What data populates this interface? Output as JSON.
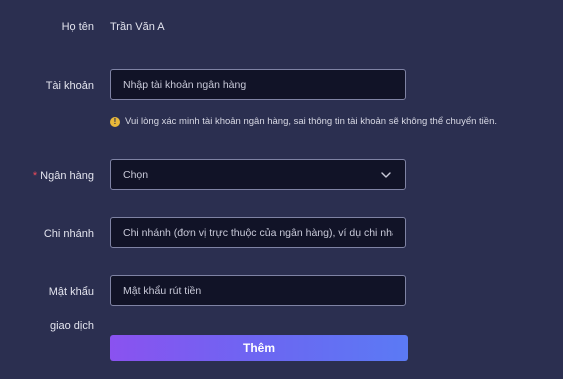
{
  "form": {
    "name": {
      "label": "Họ tên",
      "value": "Trần Văn A"
    },
    "account": {
      "label": "Tài khoản",
      "placeholder": "Nhập tài khoản ngân hàng",
      "value": "",
      "hint_icon": "info-icon",
      "hint": "Vui lòng xác minh tài khoản ngân hàng, sai thông tin tài khoản sẽ không thể chuyển tiền."
    },
    "bank": {
      "required_mark": "*",
      "label": "Ngân hàng",
      "selected": "Chọn",
      "icon": "chevron-down-icon"
    },
    "branch": {
      "label": "Chi nhánh",
      "placeholder": "Chi nhánh (đơn vị trực thuộc của ngân hàng), ví dụ chi nhánh",
      "value": ""
    },
    "password": {
      "label_line1": "Mật khẩu",
      "label_line2": "giao dịch",
      "placeholder": "Mật khẩu rút tiền",
      "value": ""
    },
    "submit_label": "Thêm"
  },
  "colors": {
    "background": "#2b2f50",
    "field_background": "#111327",
    "field_border": "#7f83a4",
    "required": "#ef4b5a",
    "info": "#e8b83a",
    "button_gradient_start": "#8a52f0",
    "button_gradient_end": "#5b7af4"
  }
}
